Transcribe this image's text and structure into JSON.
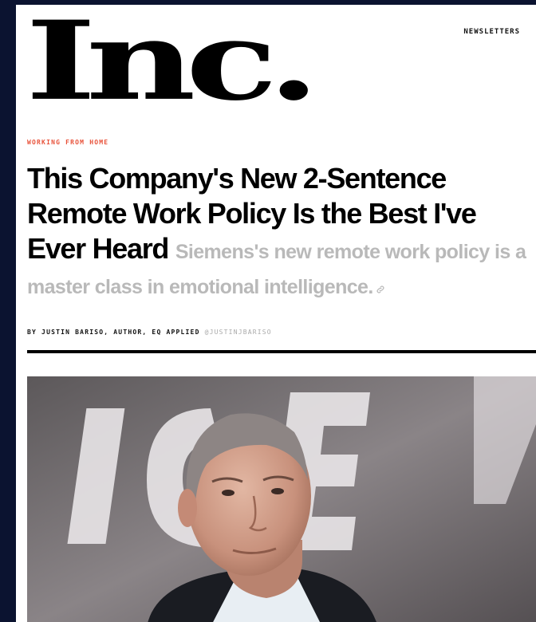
{
  "header": {
    "logo_text": "Inc.",
    "newsletters_label": "NEWSLETTERS"
  },
  "article": {
    "kicker": "WORKING FROM HOME",
    "title": "This Company's New 2-Sentence Remote Work Policy Is the Best I've Ever Heard",
    "dek": "Siemens's new remote work policy is a master class in emotional intelligence.",
    "byline": "BY JUSTIN BARISO, AUTHOR, EQ APPLIED",
    "handle": "@JUSTINJBARISO"
  },
  "hero_image": {
    "background_letters": "ICE",
    "colors": {
      "backdrop": "#7a7577",
      "letters": "#e9e6e8",
      "skin": "#d8a894",
      "suit": "#1a1c22",
      "shirt": "#e8eef3"
    }
  },
  "colors": {
    "kicker": "#e8523a",
    "dek": "#b9b9b9",
    "frame": "#0b1330"
  }
}
